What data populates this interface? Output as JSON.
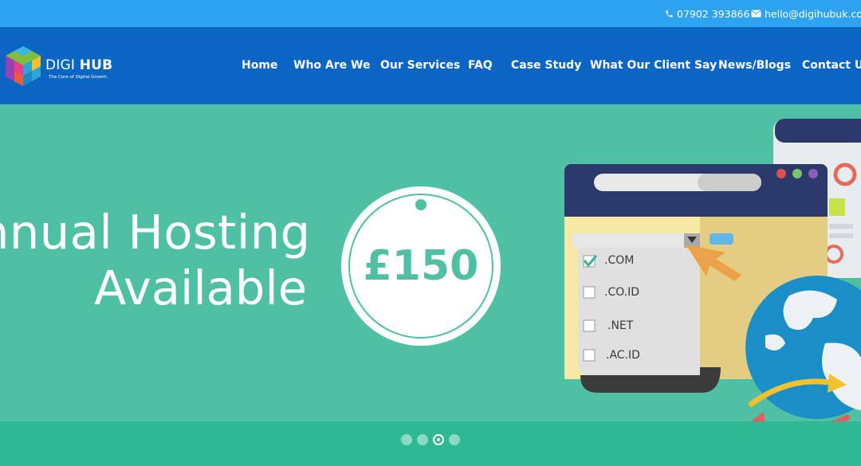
{
  "topbar": {
    "phone": "07902 393866",
    "email": "hello@digihubuk.com",
    "phone_icon": "phone-icon",
    "email_icon": "envelope-icon"
  },
  "logo": {
    "brand_light": "DIGI",
    "brand_bold": "HUB",
    "tagline": "The Core of Digital Growth"
  },
  "nav": {
    "items": [
      {
        "label": "Home"
      },
      {
        "label": "Who Are We"
      },
      {
        "label": "Our Services"
      },
      {
        "label": "FAQ"
      },
      {
        "label": "Case Study"
      },
      {
        "label": "What Our Client Say"
      },
      {
        "label": "News/Blogs"
      },
      {
        "label": "Contact Us"
      }
    ]
  },
  "hero": {
    "headline_line1": "nnual Hosting",
    "headline_line2": "Available",
    "price": "£150",
    "domains": [
      {
        "label": ".COM",
        "checked": true
      },
      {
        "label": ".CO.ID",
        "checked": false
      },
      {
        "label": ".NET",
        "checked": false
      },
      {
        "label": ".AC.ID",
        "checked": false
      }
    ]
  },
  "slider": {
    "slide_count": 4,
    "active_slide": 3
  },
  "colors": {
    "topbar": "#2ea3f2",
    "header": "#0a66c2",
    "hero_bg": "#4fc0a4",
    "slider_bar": "#2eb894"
  }
}
